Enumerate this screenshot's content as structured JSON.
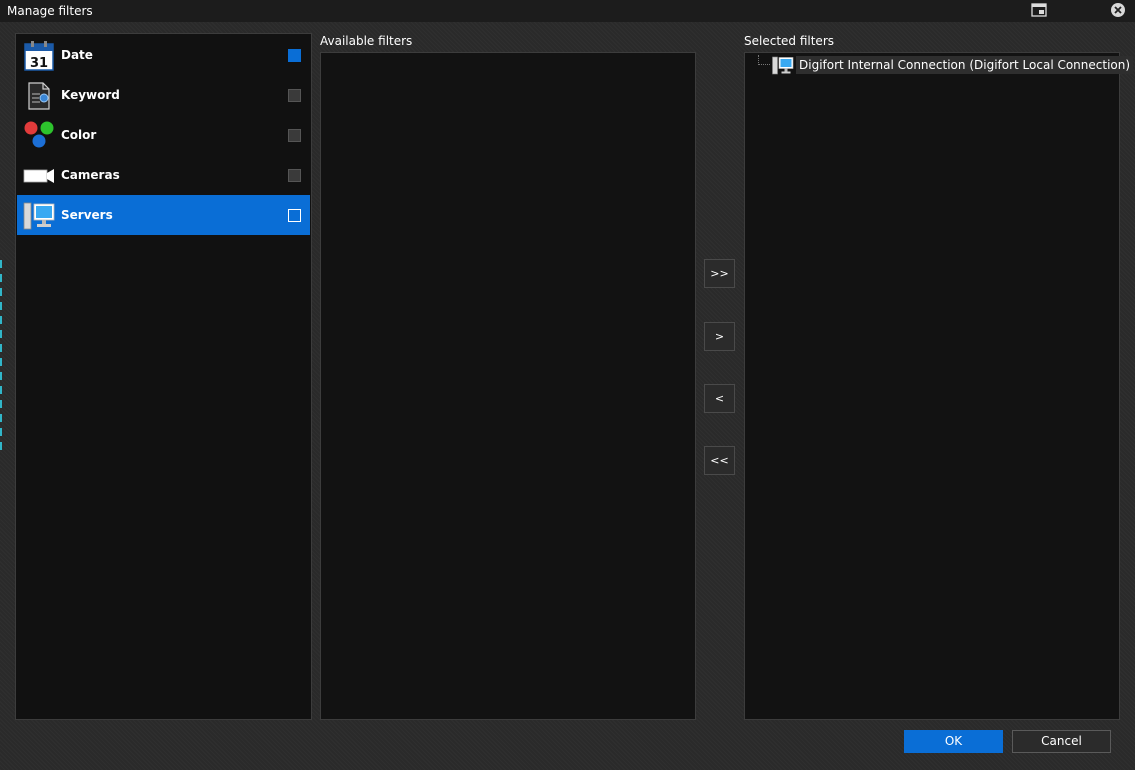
{
  "window": {
    "title": "Manage filters"
  },
  "categories": [
    {
      "label": "Date",
      "icon": "calendar-icon",
      "icon_text": "31",
      "checked": true,
      "selected": false
    },
    {
      "label": "Keyword",
      "icon": "keyword-document-icon",
      "checked": false,
      "selected": false
    },
    {
      "label": "Color",
      "icon": "color-dots-icon",
      "checked": false,
      "selected": false
    },
    {
      "label": "Cameras",
      "icon": "camera-icon",
      "checked": false,
      "selected": false
    },
    {
      "label": "Servers",
      "icon": "server-computer-icon",
      "checked": false,
      "selected": true
    }
  ],
  "available": {
    "label": "Available filters",
    "items": []
  },
  "selected": {
    "label": "Selected filters",
    "items": [
      {
        "label": "Digifort Internal Connection (Digifort Local Connection)",
        "icon": "server-computer-icon"
      }
    ]
  },
  "move_buttons": {
    "add_all": ">>",
    "add_one": ">",
    "remove_one": "<",
    "remove_all": "<<"
  },
  "dialog_buttons": {
    "ok": "OK",
    "cancel": "Cancel"
  },
  "colors": {
    "accent": "#0a6ed6",
    "panel_bg": "#121212",
    "window_bg": "#2a2a2a"
  }
}
